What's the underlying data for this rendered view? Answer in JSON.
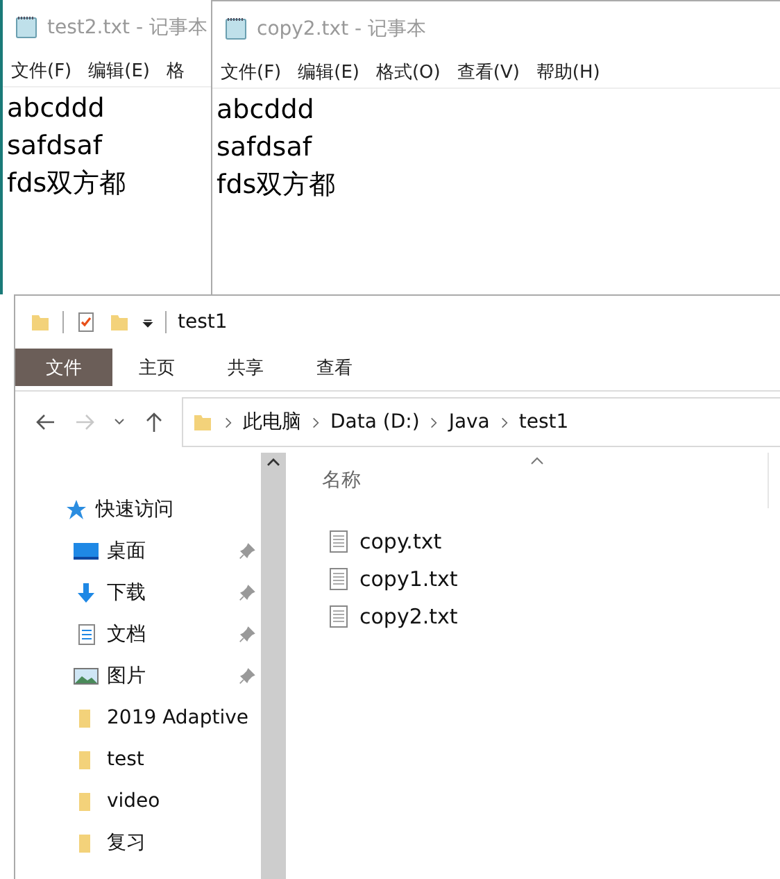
{
  "notepads": [
    {
      "title": "test2.txt - 记事本",
      "menu": [
        "文件(F)",
        "编辑(E)",
        "格"
      ],
      "lines": [
        "abcddd",
        "safdsaf",
        "fds双方都"
      ]
    },
    {
      "title": "copy2.txt - 记事本",
      "menu": [
        "文件(F)",
        "编辑(E)",
        "格式(O)",
        "查看(V)",
        "帮助(H)"
      ],
      "lines": [
        "abcddd",
        "safdsaf",
        "fds双方都"
      ]
    }
  ],
  "explorer": {
    "title": "test1",
    "ribbon_tabs": [
      {
        "label": "文件",
        "selected": true
      },
      {
        "label": "主页",
        "selected": false
      },
      {
        "label": "共享",
        "selected": false
      },
      {
        "label": "查看",
        "selected": false
      }
    ],
    "nav": {
      "forward_disabled": true
    },
    "breadcrumb": [
      "此电脑",
      "Data (D:)",
      "Java",
      "test1"
    ],
    "sidebar": {
      "items": [
        {
          "label": "快速访问",
          "kind": "star",
          "children": [
            {
              "label": "桌面",
              "kind": "desktop",
              "pinned": true
            },
            {
              "label": "下载",
              "kind": "download",
              "pinned": true
            },
            {
              "label": "文档",
              "kind": "document",
              "pinned": true
            },
            {
              "label": "图片",
              "kind": "picture",
              "pinned": true
            },
            {
              "label": "2019 Adaptive",
              "kind": "folder",
              "pinned": false
            },
            {
              "label": "test",
              "kind": "folder",
              "pinned": false
            },
            {
              "label": "video",
              "kind": "folder",
              "pinned": false
            },
            {
              "label": "复习",
              "kind": "folder",
              "pinned": false
            }
          ]
        }
      ]
    },
    "table": {
      "columns": [
        "名称"
      ],
      "rows": [
        "copy.txt",
        "copy1.txt",
        "copy2.txt"
      ]
    }
  }
}
